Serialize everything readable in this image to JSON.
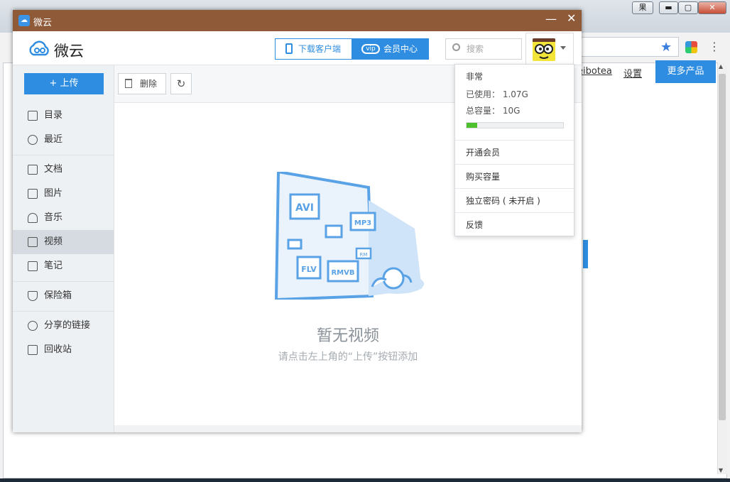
{
  "browser": {
    "title_button": "果",
    "min_symbol": "▬",
    "max_symbol": "▢",
    "close_symbol": "✕",
    "nav_weibo": "eibotea",
    "nav_settings": "设置",
    "nav_more": "更多产品",
    "bookmark_icon": "star-icon",
    "menu_icon": "⋮"
  },
  "app": {
    "window_title": "微云",
    "logo_text": "微云",
    "title_min": "—",
    "title_close": "✕",
    "header": {
      "download_label": "下载客户端",
      "vip_label": "会员中心",
      "vip_icon_text": "vip",
      "search_placeholder": "搜索"
    },
    "sidebar": {
      "upload_label": "+ 上传",
      "items": [
        {
          "label": "目录",
          "icon": "list-icon"
        },
        {
          "label": "最近",
          "icon": "clock-icon"
        },
        {
          "label": "文档",
          "icon": "document-icon"
        },
        {
          "label": "图片",
          "icon": "image-icon"
        },
        {
          "label": "音乐",
          "icon": "music-icon"
        },
        {
          "label": "视频",
          "icon": "video-icon",
          "active": true
        },
        {
          "label": "笔记",
          "icon": "note-icon"
        },
        {
          "label": "保险箱",
          "icon": "shield-icon"
        },
        {
          "label": "分享的链接",
          "icon": "link-icon"
        },
        {
          "label": "回收站",
          "icon": "trash-icon"
        }
      ]
    },
    "toolbar": {
      "delete_label": "删除",
      "refresh_symbol": "↻"
    },
    "empty_state": {
      "title": "暂无视频",
      "hint": "请点击左上角的“上传”按钮添加",
      "formats": [
        "AVI",
        "MP3",
        "FLV",
        "RMVB",
        "RM"
      ]
    },
    "account_menu": {
      "username": "非常",
      "used_label": "已使用： 1.07G",
      "total_label": "总容量： 10G",
      "usage_fraction": 0.107,
      "items": [
        "开通会员",
        "购买容量",
        "独立密码 ( 未开启 )",
        "反馈"
      ]
    }
  },
  "colors": {
    "accent": "#2e8de0",
    "titlebar": "#8e5a38",
    "progress": "#4cc12d"
  }
}
